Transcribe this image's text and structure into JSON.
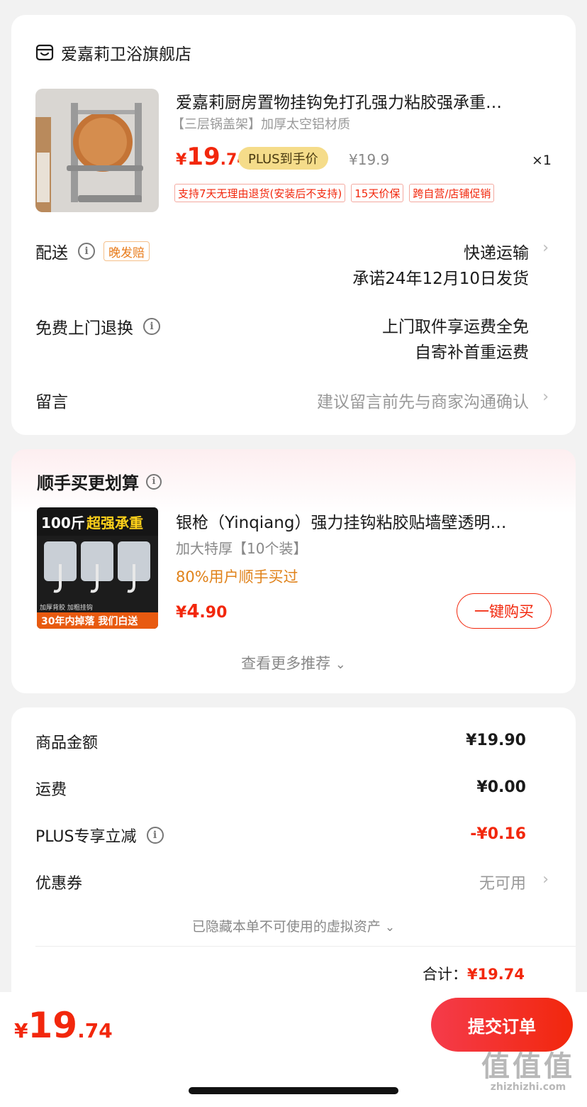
{
  "store": {
    "name": "爱嘉莉卫浴旗舰店"
  },
  "product": {
    "title": "爱嘉莉厨房置物挂钩免打孔强力粘胶强承重…",
    "spec": "【三层锅盖架】加厚太空铝材质",
    "price_yen": "¥",
    "price_int": "19",
    "price_dec": ".74",
    "plus_badge": "PLUS到手价",
    "orig_price": "¥19.9",
    "qty": "×1",
    "tags": [
      "支持7天无理由退货(安装后不支持)",
      "15天价保",
      "跨自营/店铺促销"
    ]
  },
  "delivery": {
    "label": "配送",
    "badge": "晚发赔",
    "method": "快递运输",
    "promise": "承诺24年12月10日发货"
  },
  "return_service": {
    "label": "免费上门退换",
    "line1": "上门取件享运费全免",
    "line2": "自寄补首重运费"
  },
  "message": {
    "label": "留言",
    "placeholder": "建议留言前先与商家沟通确认"
  },
  "recommend": {
    "title": "顺手买更划算",
    "image_text_top_a": "100斤",
    "image_text_top_b": "超强承重",
    "image_text_mid": "加厚背胶 加粗挂钩",
    "image_text_bottom": "30年内掉落 我们白送",
    "item_title": "银枪（Yinqiang）强力挂钩粘胶贴墙壁透明…",
    "item_sub": "加大特厚【10个装】",
    "item_pct": "80%用户顺手买过",
    "price_yen": "¥",
    "price_int": "4",
    "price_dec": ".90",
    "buy_label": "一键购买",
    "more_label": "查看更多推荐"
  },
  "summary": {
    "goods_label": "商品金额",
    "goods_value": "¥19.90",
    "shipping_label": "运费",
    "shipping_value": "¥0.00",
    "plus_label": "PLUS专享立减",
    "plus_value": "-¥0.16",
    "coupon_label": "优惠券",
    "coupon_value": "无可用",
    "hidden_note": "已隐藏本单不可使用的虚拟资产",
    "total_label": "合计：",
    "total_value": "¥19.74"
  },
  "footer": {
    "price_yen": "¥",
    "price_int": "19",
    "price_dec": ".74",
    "submit_label": "提交订单"
  },
  "watermark": {
    "big": "值值值",
    "small": "zhizhizhi.com"
  },
  "colors": {
    "accent_red": "#f2270c",
    "plus_gold": "#f5dc8a",
    "orange": "#e0821a"
  }
}
